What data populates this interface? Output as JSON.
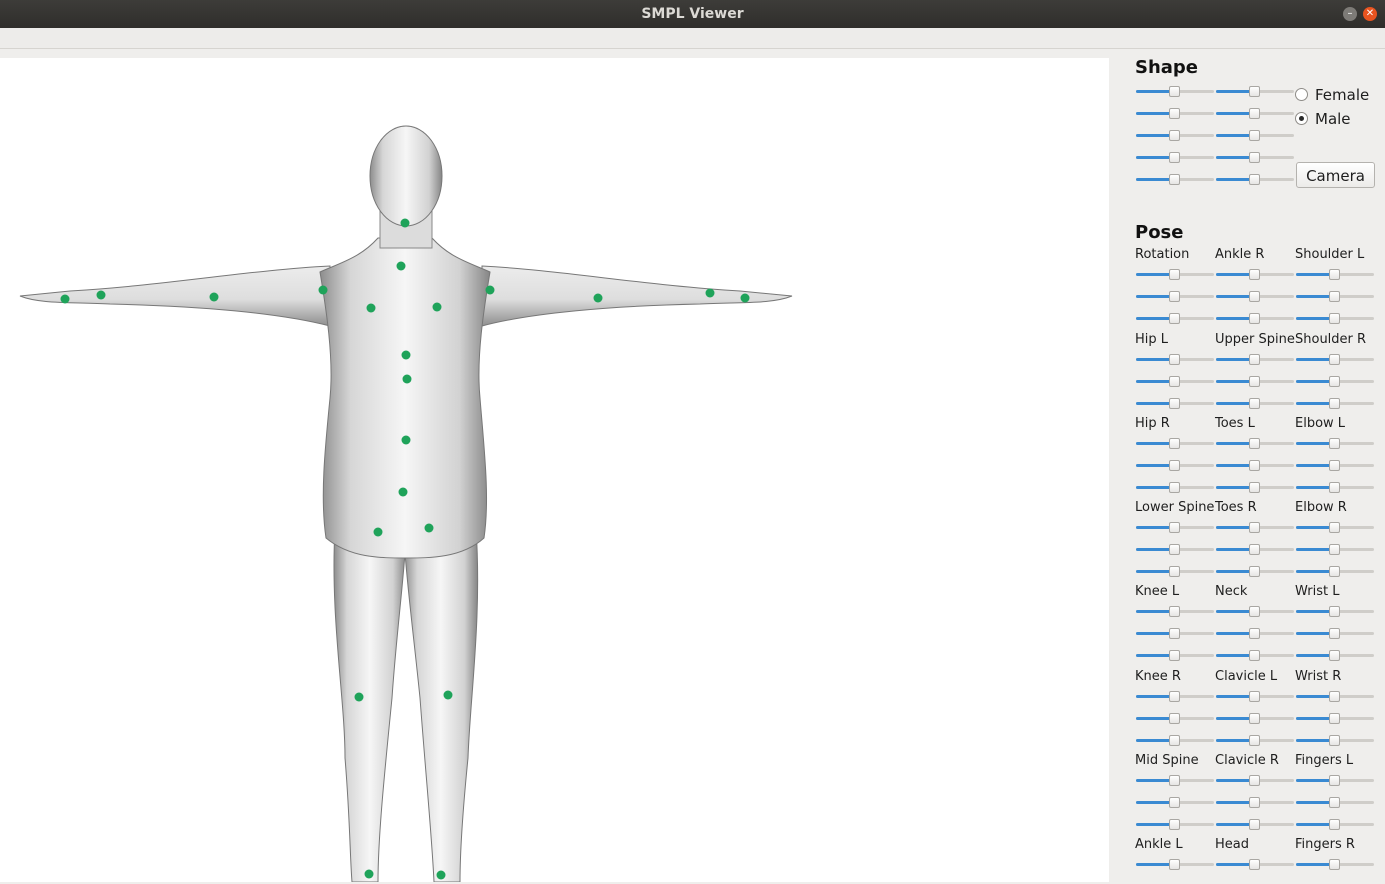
{
  "window": {
    "title": "SMPL Viewer",
    "minimize_icon": "minimize-icon",
    "close_icon": "close-icon"
  },
  "shape": {
    "heading": "Shape",
    "sliders": [
      0.5,
      0.5,
      0.5,
      0.5,
      0.5,
      0.5,
      0.5,
      0.5,
      0.5,
      0.5
    ],
    "gender_options": [
      {
        "label": "Female",
        "checked": false
      },
      {
        "label": "Male",
        "checked": true
      }
    ],
    "camera_label": "Camera"
  },
  "pose": {
    "heading": "Pose",
    "joints": [
      "Rotation",
      "Ankle R",
      "Shoulder L",
      "Hip L",
      "Upper Spine",
      "Shoulder R",
      "Hip R",
      "Toes L",
      "Elbow L",
      "Lower Spine",
      "Toes R",
      "Elbow R",
      "Knee L",
      "Neck",
      "Wrist L",
      "Knee R",
      "Clavicle L",
      "Wrist R",
      "Mid Spine",
      "Clavicle R",
      "Fingers L",
      "Ankle L",
      "Head",
      "Fingers R"
    ],
    "slider_value": 0.5
  },
  "viewport": {
    "model": "SMPL body mesh (T-pose)",
    "joint_marker_color": "#1fa35a",
    "joint_count": 24
  }
}
